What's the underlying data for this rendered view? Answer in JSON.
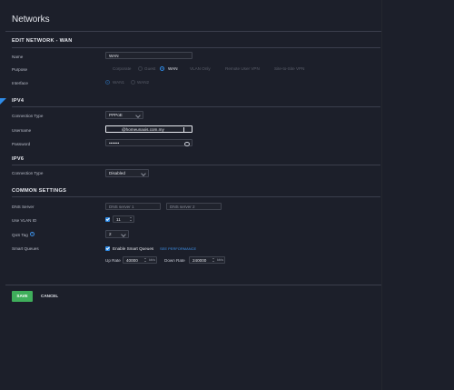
{
  "page": {
    "title": "Networks"
  },
  "header": {
    "section_title": "EDIT NETWORK - WAN"
  },
  "form": {
    "name_label": "Name",
    "name_value": "WAN",
    "purpose_label": "Purpose",
    "purpose_options": [
      "Corporate",
      "Guest",
      "WAN",
      "VLAN Only",
      "Remote User VPN",
      "Site-to-Site VPN"
    ],
    "purpose_selected": "WAN",
    "interface_label": "Interface",
    "interface_options": [
      "WAN1",
      "WAN2"
    ],
    "interface_selected": "WAN1"
  },
  "ipv4": {
    "section_title": "IPV4",
    "connection_type_label": "Connection Type",
    "connection_type_value": "PPPoE",
    "username_label": "Username",
    "username_value": "@homeunaxis.com.my",
    "password_label": "Password",
    "password_value": "•••••••"
  },
  "ipv6": {
    "section_title": "IPV6",
    "connection_type_label": "Connection Type",
    "connection_type_value": "Disabled"
  },
  "common": {
    "section_title": "COMMON SETTINGS",
    "dns_label": "DNS Server",
    "dns1_placeholder": "DNS server 1",
    "dns2_placeholder": "DNS server 2",
    "vlan_label": "Use VLAN ID",
    "vlan_value": "11",
    "qos_label": "QoS Tag",
    "qos_value": "2",
    "smart_queues_label": "Smart Queues",
    "smart_queues_check_label": "Enable Smart Queues",
    "smart_queues_link": "SEE PERFORMANCE",
    "up_rate_label": "Up Rate",
    "up_rate_value": "40000",
    "up_rate_unit": "kb/s",
    "down_rate_label": "Down Rate",
    "down_rate_value": "240000",
    "down_rate_unit": "kb/s"
  },
  "actions": {
    "save": "SAVE",
    "cancel": "CANCEL"
  },
  "colors": {
    "accent": "#2f8ce8",
    "save": "#3fae5b",
    "background": "#1c1f2a"
  }
}
